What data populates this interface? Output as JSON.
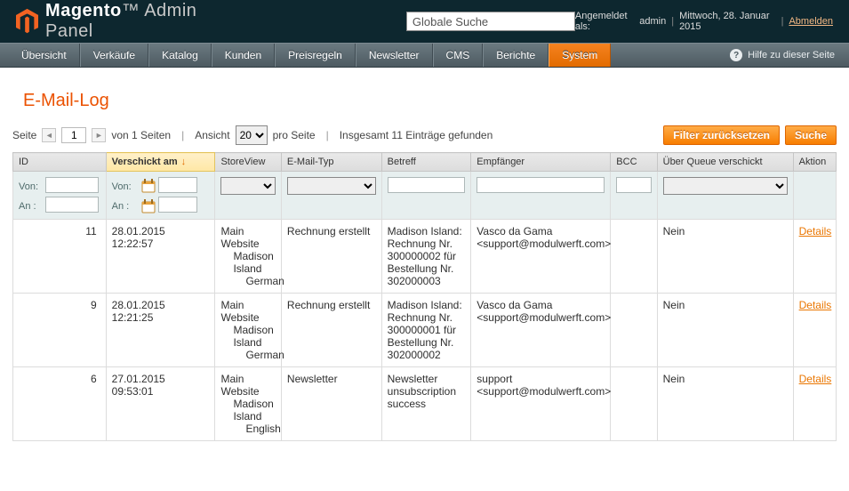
{
  "header": {
    "brand_main": "Magento",
    "brand_sub": "Admin Panel",
    "search_value": "Globale Suche",
    "logged_in_prefix": "Angemeldet als:",
    "logged_in_user": "admin",
    "date": "Mittwoch, 28. Januar 2015",
    "logout": "Abmelden"
  },
  "nav": {
    "items": [
      {
        "label": "Übersicht",
        "active": false
      },
      {
        "label": "Verkäufe",
        "active": false
      },
      {
        "label": "Katalog",
        "active": false
      },
      {
        "label": "Kunden",
        "active": false
      },
      {
        "label": "Preisregeln",
        "active": false
      },
      {
        "label": "Newsletter",
        "active": false
      },
      {
        "label": "CMS",
        "active": false
      },
      {
        "label": "Berichte",
        "active": false
      },
      {
        "label": "System",
        "active": true
      }
    ],
    "help": "Hilfe zu dieser Seite"
  },
  "page_title": "E-Mail-Log",
  "pager": {
    "page_label": "Seite",
    "page_value": "1",
    "of_pages": "von 1 Seiten",
    "view_label": "Ansicht",
    "per_page_value": "20",
    "per_page_label": "pro Seite",
    "total_label": "Insgesamt 11 Einträge gefunden",
    "reset_filter": "Filter zurücksetzen",
    "search": "Suche"
  },
  "grid": {
    "headers": {
      "id": "ID",
      "sent_at": "Verschickt am",
      "store": "StoreView",
      "type": "E-Mail-Typ",
      "subject": "Betreff",
      "recipient": "Empfänger",
      "bcc": "BCC",
      "via_queue": "Über Queue verschickt",
      "action": "Aktion"
    },
    "filter_labels": {
      "from": "Von:",
      "to": "An :"
    },
    "rows": [
      {
        "id": "11",
        "sent_at": "28.01.2015 12:22:57",
        "store": {
          "l0": "Main Website",
          "l1": "Madison Island",
          "l2": "German"
        },
        "type": "Rechnung erstellt",
        "subject": "Madison Island: Rechnung Nr. 300000002 für Bestellung Nr. 302000003",
        "recipient": "Vasco da Gama <support@modulwerft.com>",
        "bcc": "",
        "via_queue": "Nein",
        "action": "Details"
      },
      {
        "id": "9",
        "sent_at": "28.01.2015 12:21:25",
        "store": {
          "l0": "Main Website",
          "l1": "Madison Island",
          "l2": "German"
        },
        "type": "Rechnung erstellt",
        "subject": "Madison Island: Rechnung Nr. 300000001 für Bestellung Nr. 302000002",
        "recipient": "Vasco da Gama <support@modulwerft.com>",
        "bcc": "",
        "via_queue": "Nein",
        "action": "Details"
      },
      {
        "id": "6",
        "sent_at": "27.01.2015 09:53:01",
        "store": {
          "l0": "Main Website",
          "l1": "Madison Island",
          "l2": "English"
        },
        "type": "Newsletter",
        "subject": "Newsletter unsubscription success",
        "recipient": "support <support@modulwerft.com>",
        "bcc": "",
        "via_queue": "Nein",
        "action": "Details"
      }
    ]
  }
}
